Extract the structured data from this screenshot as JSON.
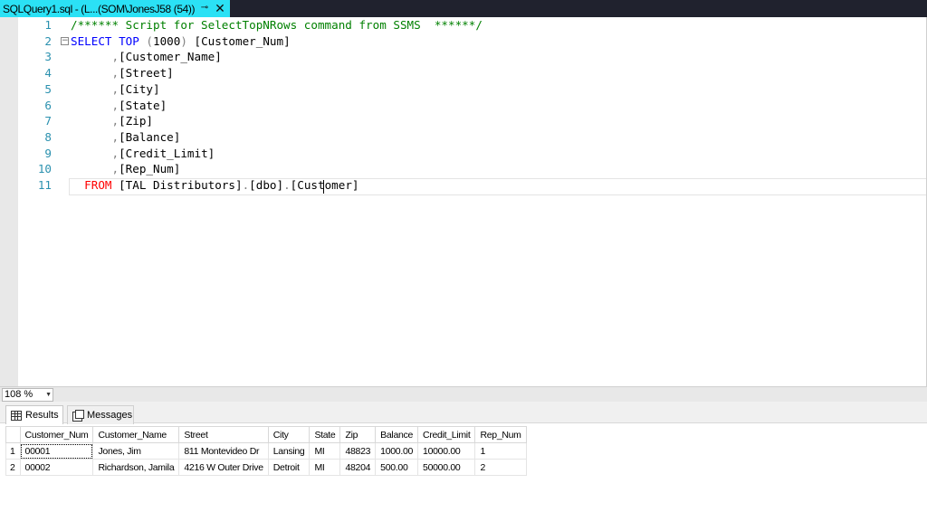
{
  "tab": {
    "title": "SQLQuery1.sql - (L...(SOM\\JonesJ58 (54))",
    "pin_icon": "pin-icon",
    "close_icon": "close-icon"
  },
  "editor": {
    "lines": [
      {
        "num": "1",
        "segments": [
          {
            "t": "/****** Script for SelectTopNRows command from SSMS  ******/",
            "c": "cmt"
          }
        ]
      },
      {
        "num": "2",
        "fold": "⊟",
        "segments": [
          {
            "t": "SELECT TOP",
            "c": "kw"
          },
          {
            "t": " (",
            "c": "gray"
          },
          {
            "t": "1000",
            "c": ""
          },
          {
            "t": ")",
            "c": "gray"
          },
          {
            "t": " [Customer_Num]",
            "c": ""
          }
        ]
      },
      {
        "num": "3",
        "segments": [
          {
            "t": "      ,",
            "c": "gray"
          },
          {
            "t": "[Customer_Name]",
            "c": ""
          }
        ]
      },
      {
        "num": "4",
        "segments": [
          {
            "t": "      ,",
            "c": "gray"
          },
          {
            "t": "[Street]",
            "c": ""
          }
        ]
      },
      {
        "num": "5",
        "segments": [
          {
            "t": "      ,",
            "c": "gray"
          },
          {
            "t": "[City]",
            "c": ""
          }
        ]
      },
      {
        "num": "6",
        "segments": [
          {
            "t": "      ,",
            "c": "gray"
          },
          {
            "t": "[State]",
            "c": ""
          }
        ]
      },
      {
        "num": "7",
        "segments": [
          {
            "t": "      ,",
            "c": "gray"
          },
          {
            "t": "[Zip]",
            "c": ""
          }
        ]
      },
      {
        "num": "8",
        "segments": [
          {
            "t": "      ,",
            "c": "gray"
          },
          {
            "t": "[Balance]",
            "c": ""
          }
        ]
      },
      {
        "num": "9",
        "segments": [
          {
            "t": "      ,",
            "c": "gray"
          },
          {
            "t": "[Credit_Limit]",
            "c": ""
          }
        ]
      },
      {
        "num": "10",
        "segments": [
          {
            "t": "      ,",
            "c": "gray"
          },
          {
            "t": "[Rep_Num]",
            "c": ""
          }
        ]
      },
      {
        "num": "11",
        "segments": [
          {
            "t": "  FROM",
            "c": "kw-red"
          },
          {
            "t": " [TAL Distributors]",
            "c": ""
          },
          {
            "t": ".",
            "c": "gray"
          },
          {
            "t": "[dbo]",
            "c": ""
          },
          {
            "t": ".",
            "c": "gray"
          },
          {
            "t": "[Customer]",
            "c": ""
          }
        ]
      }
    ]
  },
  "zoom": {
    "value": "108 %"
  },
  "results_tabs": {
    "results_label": "Results",
    "messages_label": "Messages"
  },
  "grid": {
    "columns": [
      "",
      "Customer_Num",
      "Customer_Name",
      "Street",
      "City",
      "State",
      "Zip",
      "Balance",
      "Credit_Limit",
      "Rep_Num"
    ],
    "rows": [
      [
        "1",
        "00001",
        "Jones, Jim",
        "811 Montevideo Dr",
        "Lansing",
        "MI",
        "48823",
        "1000.00",
        "10000.00",
        "1"
      ],
      [
        "2",
        "00002",
        "Richardson, Jamila",
        "4216 W Outer Drive",
        "Detroit",
        "MI",
        "48204",
        "500.00",
        "50000.00",
        "2"
      ]
    ]
  },
  "colors": {
    "tab_active": "#2be1f5",
    "titlebar": "#20222e",
    "line_number": "#2b91af",
    "keyword": "#0000ff",
    "comment": "#008000",
    "from_keyword": "#ff0000"
  }
}
